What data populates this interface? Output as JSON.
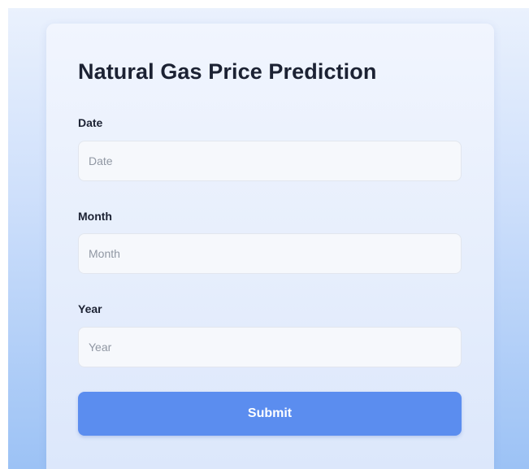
{
  "form": {
    "title": "Natural Gas Price Prediction",
    "fields": [
      {
        "label": "Date",
        "placeholder": "Date",
        "value": ""
      },
      {
        "label": "Month",
        "placeholder": "Month",
        "value": ""
      },
      {
        "label": "Year",
        "placeholder": "Year",
        "value": ""
      }
    ],
    "submit_label": "Submit"
  },
  "colors": {
    "background_top": "#eaf1fd",
    "background_bottom": "#9cc2f5",
    "card": "#eef3fd",
    "input_background": "#f6f8fc",
    "button": "#5b8def",
    "button_text": "#ffffff",
    "text": "#1c2233",
    "placeholder": "#9097a3"
  }
}
